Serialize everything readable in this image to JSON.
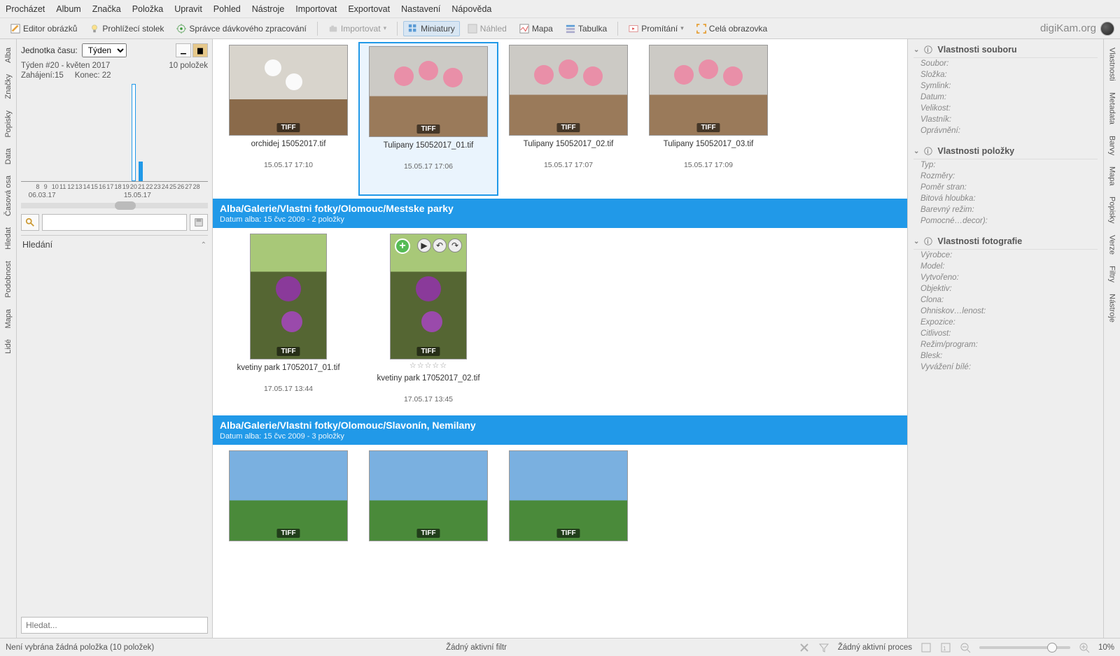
{
  "menu": [
    "Procházet",
    "Album",
    "Značka",
    "Položka",
    "Upravit",
    "Pohled",
    "Nástroje",
    "Importovat",
    "Exportovat",
    "Nastavení",
    "Nápověda"
  ],
  "toolbar": {
    "editor": "Editor obrázků",
    "lighttable": "Prohlížecí stolek",
    "batch": "Správce dávkového zpracování",
    "import": "Importovat",
    "thumbs": "Miniatury",
    "preview": "Náhled",
    "map": "Mapa",
    "table": "Tabulka",
    "slideshow": "Promítání",
    "fullscreen": "Celá obrazovka",
    "brand": "digiKam.org"
  },
  "ltabs": [
    "Alba",
    "Značky",
    "Popisky",
    "Data",
    "Časová osa",
    "Hledat",
    "Podobnost",
    "Mapa",
    "Lidé"
  ],
  "rtabs": [
    "Vlastnosti",
    "Metadata",
    "Barvy",
    "Mapa",
    "Popisky",
    "Verze",
    "Filtry",
    "Nástroje"
  ],
  "timeline": {
    "unit_label": "Jednotka času:",
    "unit_value": "Týden",
    "week": "Týden #20 - květen 2017",
    "count": "10 položek",
    "start": "Zahájení:15",
    "end": "Konec: 22",
    "axis_left": "06.03.17",
    "axis_right": "15.05.17",
    "ticks": [
      "8",
      "9",
      "10",
      "11",
      "12",
      "13",
      "14",
      "15",
      "16",
      "17",
      "18",
      "19",
      "20",
      "21",
      "22",
      "23",
      "24",
      "25",
      "26",
      "27",
      "28"
    ],
    "hledani": "Hledání",
    "search_placeholder": "Hledat..."
  },
  "groups": [
    {
      "title": "",
      "sub": "",
      "items": [
        {
          "name": "orchidej 15052017.tif",
          "date": "15.05.17 17:10",
          "badge": "TIFF",
          "ph": "ph-orchid"
        },
        {
          "name": "Tulipany 15052017_01.tif",
          "date": "15.05.17 17:06",
          "badge": "TIFF",
          "ph": "ph-tulip",
          "selected": true
        },
        {
          "name": "Tulipany 15052017_02.tif",
          "date": "15.05.17 17:07",
          "badge": "TIFF",
          "ph": "ph-tulip"
        },
        {
          "name": "Tulipany 15052017_03.tif",
          "date": "15.05.17 17:09",
          "badge": "TIFF",
          "ph": "ph-tulip"
        }
      ]
    },
    {
      "title": "Alba/Galerie/Vlastni fotky/Olomouc/Mestske parky",
      "sub": "Datum alba: 15 čvc 2009 - 2 položky",
      "items": [
        {
          "name": "kvetiny park 17052017_01.tif",
          "date": "17.05.17 13:44",
          "badge": "TIFF",
          "ph": "ph-purple",
          "tall": true
        },
        {
          "name": "kvetiny park 17052017_02.tif",
          "date": "17.05.17 13:45",
          "badge": "TIFF",
          "ph": "ph-purple",
          "tall": true,
          "hover": true,
          "stars": "☆☆☆☆☆"
        }
      ]
    },
    {
      "title": "Alba/Galerie/Vlastni fotky/Olomouc/Slavonín, Nemilany",
      "sub": "Datum alba: 15 čvc 2009 - 3 položky",
      "items": [
        {
          "name": "",
          "date": "",
          "badge": "TIFF",
          "ph": "ph-sky"
        },
        {
          "name": "",
          "date": "",
          "badge": "TIFF",
          "ph": "ph-sky"
        },
        {
          "name": "",
          "date": "",
          "badge": "TIFF",
          "ph": "ph-sky"
        }
      ]
    }
  ],
  "props": {
    "file": {
      "head": "Vlastnosti souboru",
      "rows": [
        "Soubor:",
        "Složka:",
        "Symlink:",
        "Datum:",
        "Velikost:",
        "Vlastník:",
        "Oprávnění:"
      ]
    },
    "item": {
      "head": "Vlastnosti položky",
      "rows": [
        "Typ:",
        "Rozměry:",
        "Poměr stran:",
        "Bitová hloubka:",
        "Barevný režim:",
        "Pomocné…decor):"
      ]
    },
    "photo": {
      "head": "Vlastnosti fotografie",
      "rows": [
        "Výrobce:",
        "Model:",
        "Vytvořeno:",
        "Objektiv:",
        "Clona:",
        "Ohniskov…lenost:",
        "Expozice:",
        "Citlivost:",
        "Režim/program:",
        "Blesk:",
        "Vyvážení bílé:"
      ]
    }
  },
  "status": {
    "left": "Není vybrána žádná položka (10 položek)",
    "filter": "Žádný aktivní filtr",
    "process": "Žádný aktivní proces",
    "zoom": "10%"
  }
}
